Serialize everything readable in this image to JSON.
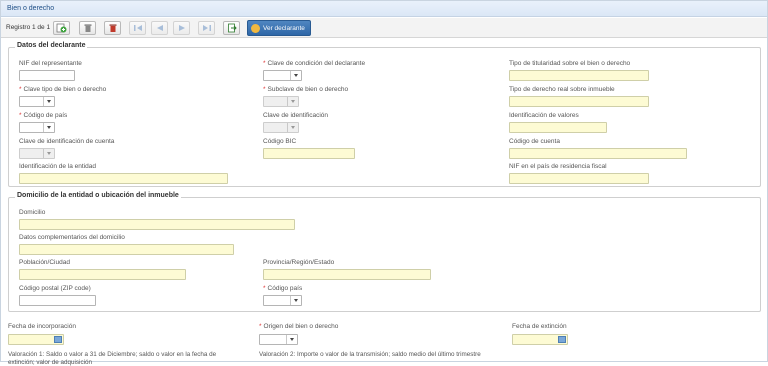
{
  "header": {
    "title": "Bien o derecho"
  },
  "toolbar": {
    "record_counter": "Registro 1 de 1",
    "ver_declarante_label": "Ver declarante"
  },
  "declarante": {
    "legend": "Datos del declarante",
    "nif_representante": "NIF del representante",
    "clave_condicion": "Clave de condición del declarante",
    "tipo_titularidad": "Tipo de titularidad sobre el bien o derecho",
    "clave_tipo_bien": "Clave tipo de bien o derecho",
    "subclave_bien": "Subclave de bien o derecho",
    "tipo_derecho_real": "Tipo de derecho real sobre inmueble",
    "codigo_pais": "Código de país",
    "clave_identificacion": "Clave de identificación",
    "identificacion_valores": "Identificación de valores",
    "clave_identificacion_cuenta": "Clave de identificación de cuenta",
    "codigo_bic": "Código BIC",
    "codigo_cuenta": "Código de cuenta",
    "identificacion_entidad": "Identificación de la entidad",
    "nif_pais_residencia": "NIF en el país de residencia fiscal"
  },
  "domicilio": {
    "legend": "Domicilio de la entidad o ubicación del inmueble",
    "domicilio": "Domicilio",
    "datos_complementarios": "Datos complementarios del domicilio",
    "poblacion": "Población/Ciudad",
    "provincia": "Provincia/Región/Estado",
    "codigo_postal": "Código postal (ZIP code)",
    "codigo_pais": "Código país"
  },
  "footer": {
    "fecha_incorporacion": "Fecha de incorporación",
    "origen_bien": "Origen del bien o derecho",
    "fecha_extincion": "Fecha de extinción",
    "valoracion1": "Valoración 1: Saldo o valor a 31 de Diciembre; saldo o valor en la fecha de",
    "valoracion1_cont": "extinción; valor de adquisición",
    "valoracion2": "Valoración 2: Importe o valor de la transmisión; saldo medio del último trimestre"
  },
  "colors": {
    "header_text": "#1f4f86",
    "primary_button": "#2f67a7",
    "required_mark": "#dd3333",
    "input_fill": "#fdfbd4"
  }
}
